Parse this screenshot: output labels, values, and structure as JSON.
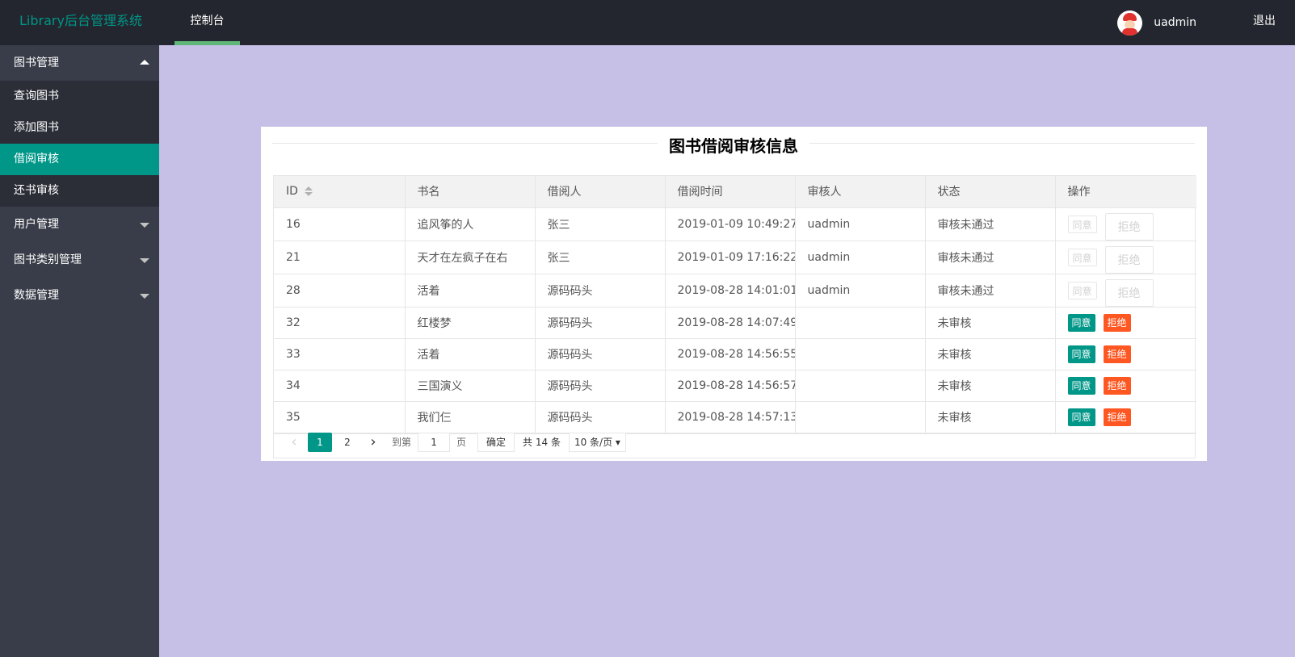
{
  "app": {
    "logo": "Library后台管理系统",
    "nav_tab": "控制台",
    "username": "uadmin",
    "logout": "退出"
  },
  "sidebar": {
    "groups": [
      {
        "label": "图书管理",
        "expanded": true,
        "items": [
          "查询图书",
          "添加图书",
          "借阅审核",
          "还书审核"
        ],
        "active_item": "借阅审核"
      },
      {
        "label": "用户管理",
        "expanded": false
      },
      {
        "label": "图书类别管理",
        "expanded": false
      },
      {
        "label": "数据管理",
        "expanded": false
      }
    ]
  },
  "card": {
    "title": "图书借阅审核信息",
    "columns": [
      "ID",
      "书名",
      "借阅人",
      "借阅时间",
      "审核人",
      "状态",
      "操作"
    ],
    "rows": [
      {
        "id": "16",
        "book": "追风筝的人",
        "borrower": "张三",
        "time": "2019-01-09 10:49:27",
        "auditor": "uadmin",
        "status": "审核未通过",
        "actions_enabled": false
      },
      {
        "id": "21",
        "book": "天才在左疯子在右",
        "borrower": "张三",
        "time": "2019-01-09 17:16:22",
        "auditor": "uadmin",
        "status": "审核未通过",
        "actions_enabled": false
      },
      {
        "id": "28",
        "book": "活着",
        "borrower": "源码码头",
        "time": "2019-08-28 14:01:01",
        "auditor": "uadmin",
        "status": "审核未通过",
        "actions_enabled": false
      },
      {
        "id": "32",
        "book": "红楼梦",
        "borrower": "源码码头",
        "time": "2019-08-28 14:07:49",
        "auditor": "",
        "status": "未审核",
        "actions_enabled": true
      },
      {
        "id": "33",
        "book": "活着",
        "borrower": "源码码头",
        "time": "2019-08-28 14:56:55",
        "auditor": "",
        "status": "未审核",
        "actions_enabled": true
      },
      {
        "id": "34",
        "book": "三国演义",
        "borrower": "源码码头",
        "time": "2019-08-28 14:56:57",
        "auditor": "",
        "status": "未审核",
        "actions_enabled": true
      },
      {
        "id": "35",
        "book": "我们仨",
        "borrower": "源码码头",
        "time": "2019-08-28 14:57:13",
        "auditor": "",
        "status": "未审核",
        "actions_enabled": true
      }
    ],
    "action_labels": {
      "approve": "同意",
      "reject": "拒绝"
    },
    "pager": {
      "pages": [
        "1",
        "2"
      ],
      "current": "1",
      "goto_label": "到第",
      "goto_value": "1",
      "page_unit": "页",
      "confirm": "确定",
      "total": "共 14 条",
      "page_size": "10 条/页"
    }
  },
  "colors": {
    "accent": "#009688",
    "danger": "#ff5722",
    "topbar": "#23262e",
    "sidebar": "#393d49",
    "content_bg": "#c6bfe6"
  }
}
